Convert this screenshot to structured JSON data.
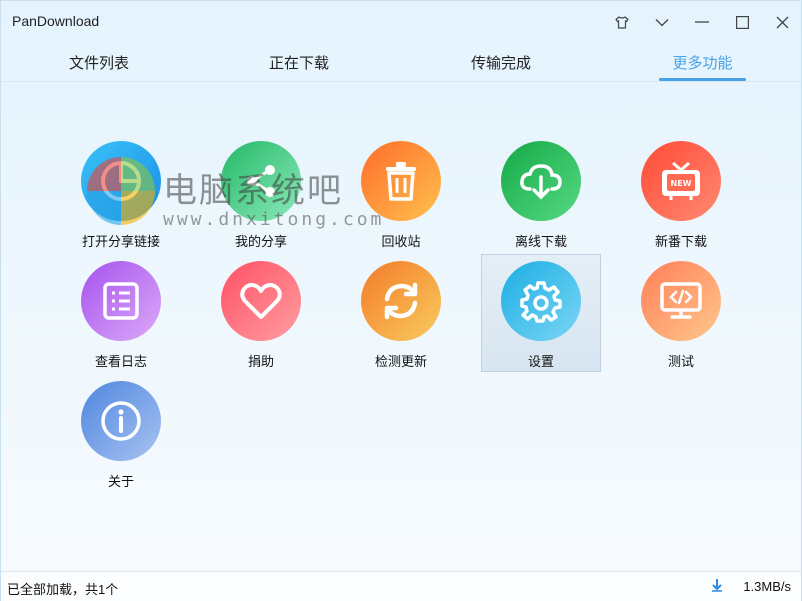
{
  "window": {
    "title": "PanDownload"
  },
  "tabs": [
    {
      "label": "文件列表",
      "active": false
    },
    {
      "label": "正在下载",
      "active": false
    },
    {
      "label": "传输完成",
      "active": false
    },
    {
      "label": "更多功能",
      "active": true
    }
  ],
  "features": [
    {
      "label": "打开分享链接",
      "icon": "pie-chart-icon",
      "gradient": [
        "#3ab8f5",
        "#1e96e8"
      ]
    },
    {
      "label": "我的分享",
      "icon": "share-icon",
      "gradient": [
        "#2fbf6f",
        "#8be8b8"
      ]
    },
    {
      "label": "回收站",
      "icon": "trash-icon",
      "gradient": [
        "#ff7a30",
        "#ffb64a"
      ]
    },
    {
      "label": "离线下载",
      "icon": "cloud-download-icon",
      "gradient": [
        "#19b34e",
        "#4fd47e"
      ]
    },
    {
      "label": "新番下载",
      "icon": "tv-new-icon",
      "gradient": [
        "#ff5a3c",
        "#ff8a6a"
      ]
    },
    {
      "label": "查看日志",
      "icon": "log-list-icon",
      "gradient": [
        "#a95cf0",
        "#d9a6f7"
      ]
    },
    {
      "label": "捐助",
      "icon": "heart-icon",
      "gradient": [
        "#ff5f6d",
        "#ff9a9e"
      ]
    },
    {
      "label": "检测更新",
      "icon": "refresh-icon",
      "gradient": [
        "#f6852f",
        "#f9c45a"
      ]
    },
    {
      "label": "设置",
      "icon": "gear-icon",
      "gradient": [
        "#25b6e6",
        "#72d1f3"
      ],
      "selected": true
    },
    {
      "label": "测试",
      "icon": "code-monitor-icon",
      "gradient": [
        "#ff8a5c",
        "#ffc38a"
      ]
    },
    {
      "label": "关于",
      "icon": "info-icon",
      "gradient": [
        "#5b8fe0",
        "#a6c1f2"
      ]
    }
  ],
  "watermark": {
    "line1": "电脑系统吧",
    "line2": "www.dnxitong.com"
  },
  "status": {
    "text": "已全部加载，共1个",
    "speed": "1.3MB/s"
  },
  "colors": {
    "accent": "#4aa3e6",
    "background": "#eaf5fc"
  }
}
